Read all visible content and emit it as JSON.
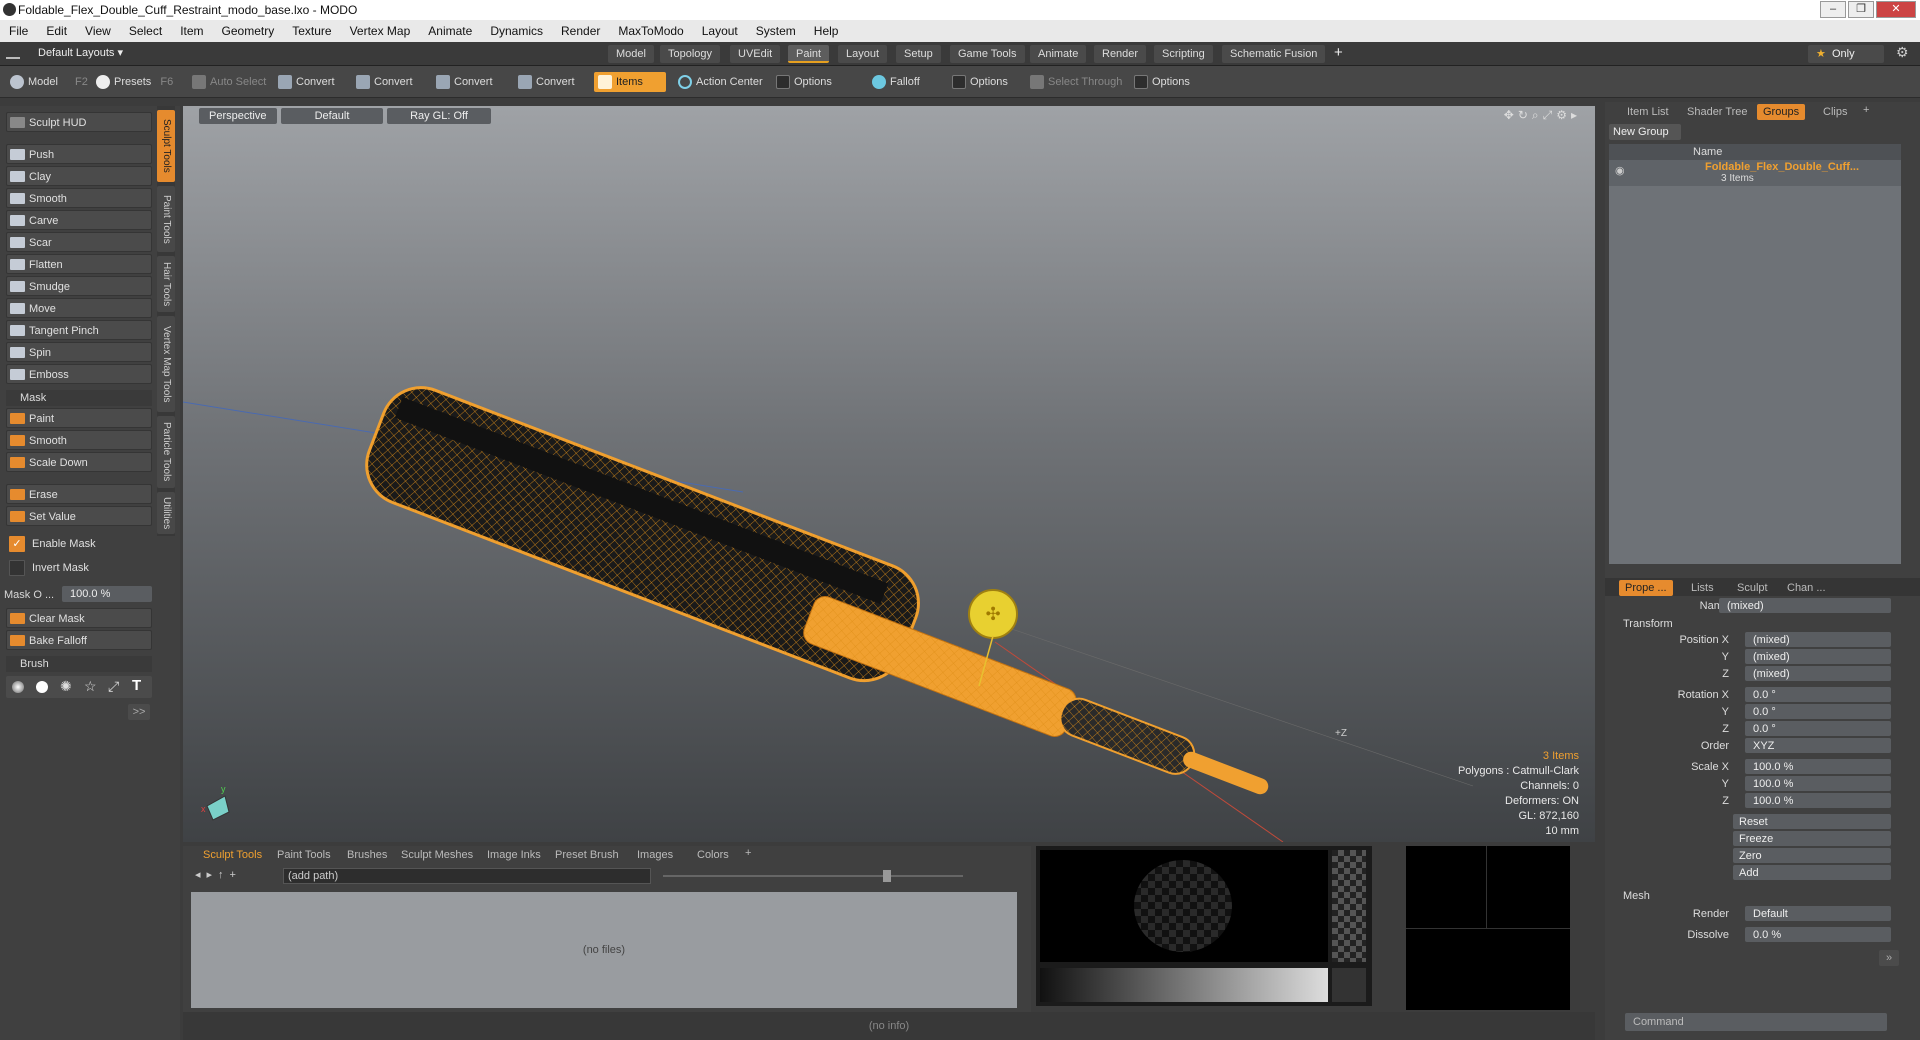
{
  "window": {
    "title": "Foldable_Flex_Double_Cuff_Restraint_modo_base.lxo - MODO"
  },
  "menu": [
    "File",
    "Edit",
    "View",
    "Select",
    "Item",
    "Geometry",
    "Texture",
    "Vertex Map",
    "Animate",
    "Dynamics",
    "Render",
    "MaxToModo",
    "Layout",
    "System",
    "Help"
  ],
  "layoutbar": {
    "default_layouts": "Default Layouts ▾",
    "tabs": [
      "Model",
      "Topology",
      "UVEdit",
      "Paint",
      "Layout",
      "Setup",
      "Game Tools",
      "Animate",
      "Render",
      "Scripting",
      "Schematic Fusion"
    ],
    "active": "Paint",
    "only": "Only"
  },
  "toolbar": {
    "model": "Model",
    "model_key": "F2",
    "presets": "Presets",
    "presets_key": "F6",
    "auto_select": "Auto Select",
    "convert": "Convert",
    "items": "Items",
    "action_center": "Action Center",
    "options": "Options",
    "falloff": "Falloff",
    "select_through": "Select Through"
  },
  "left": {
    "sculpt_hud": "Sculpt HUD",
    "tools": [
      "Push",
      "Clay",
      "Smooth",
      "Carve",
      "Scar",
      "Flatten",
      "Smudge",
      "Move",
      "Tangent Pinch",
      "Spin",
      "Emboss"
    ],
    "mask_header": "Mask",
    "mask_tools": [
      "Paint",
      "Smooth",
      "Scale Down"
    ],
    "erase": "Erase",
    "set_value": "Set Value",
    "enable_mask": "Enable Mask",
    "invert_mask": "Invert Mask",
    "mask_opacity_label": "Mask O ...",
    "mask_opacity_value": "100.0 %",
    "clear_mask": "Clear Mask",
    "bake_falloff": "Bake Falloff",
    "brush_header": "Brush",
    "more": ">>"
  },
  "vtabs": [
    "Sculpt Tools",
    "Paint Tools",
    "Hair Tools",
    "Vertex Map Tools",
    "Particle Tools",
    "Utilities"
  ],
  "viewport": {
    "view": "Perspective",
    "shading": "Default",
    "raygl": "Ray GL: Off",
    "info": {
      "items": "3 Items",
      "polygons": "Polygons : Catmull-Clark",
      "channels": "Channels: 0",
      "deformers": "Deformers: ON",
      "gl": "GL: 872,160",
      "scale": "10 mm"
    },
    "axis_label": "+Z"
  },
  "bottom": {
    "tabs": [
      "Sculpt Tools",
      "Paint Tools",
      "Brushes",
      "Sculpt Meshes",
      "Image Inks",
      "Preset Brush",
      "Images",
      "Colors"
    ],
    "path": "(add path)",
    "no_files": "(no files)",
    "status": "(no info)"
  },
  "right": {
    "tabs": [
      "Item List",
      "Shader Tree",
      "Groups",
      "Clips"
    ],
    "new_group": "New Group",
    "name_col": "Name",
    "group_name": "Foldable_Flex_Double_Cuff...",
    "group_count": "3 Items",
    "prop_tabs": [
      "Prope ...",
      "Lists",
      "Sculpt",
      "Chan ..."
    ],
    "name_label": "Name",
    "name_value": "(mixed)",
    "transform": "Transform",
    "pos": [
      [
        "Position X",
        "(mixed)"
      ],
      [
        "Y",
        "(mixed)"
      ],
      [
        "Z",
        "(mixed)"
      ]
    ],
    "rot": [
      [
        "Rotation X",
        "0.0 °"
      ],
      [
        "Y",
        "0.0 °"
      ],
      [
        "Z",
        "0.0 °"
      ]
    ],
    "order_label": "Order",
    "order_value": "XYZ",
    "scale": [
      [
        "Scale X",
        "100.0 %"
      ],
      [
        "Y",
        "100.0 %"
      ],
      [
        "Z",
        "100.0 %"
      ]
    ],
    "actions": [
      "Reset",
      "Freeze",
      "Zero",
      "Add"
    ],
    "mesh": "Mesh",
    "render_label": "Render",
    "render_value": "Default",
    "dissolve_label": "Dissolve",
    "dissolve_value": "0.0 %",
    "command_placeholder": "Command"
  }
}
